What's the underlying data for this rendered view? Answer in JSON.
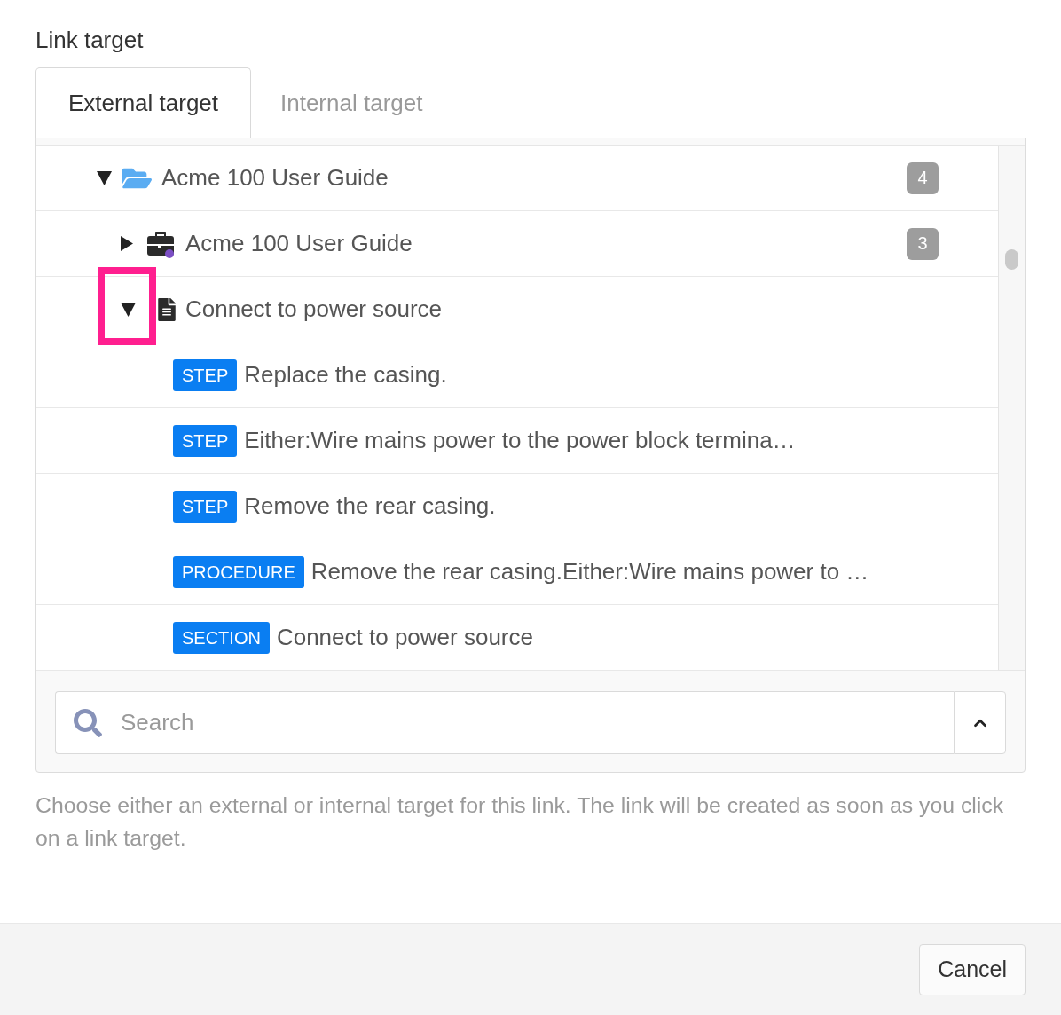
{
  "dialog": {
    "title": "Link target"
  },
  "tabs": [
    {
      "label": "External target",
      "selected": true
    },
    {
      "label": "Internal target",
      "selected": false
    }
  ],
  "tree": [
    {
      "kind": "folder",
      "label": "Acme 100 User Guide",
      "count": "4",
      "expanded": true,
      "highlighted": false,
      "children": [
        {
          "kind": "briefcase",
          "label": "Acme 100 User Guide",
          "count": "3",
          "expanded": false,
          "highlighted": false
        },
        {
          "kind": "document",
          "label": "Connect to power source",
          "expanded": true,
          "highlighted": true,
          "children": [
            {
              "kind": "entry",
              "badge": "STEP",
              "label": "Replace the casing."
            },
            {
              "kind": "entry",
              "badge": "STEP",
              "label": "Either:Wire mains power to the power block termina…"
            },
            {
              "kind": "entry",
              "badge": "STEP",
              "label": "Remove the rear casing."
            },
            {
              "kind": "entry",
              "badge": "PROCEDURE",
              "label": "Remove the rear casing.Either:Wire mains power to …"
            },
            {
              "kind": "entry",
              "badge": "SECTION",
              "label": "Connect to power source"
            }
          ]
        }
      ]
    }
  ],
  "search": {
    "placeholder": "Search"
  },
  "help_text": "Choose either an external or internal target for this link. The link will be created as soon as you click on a link target.",
  "buttons": [
    "Cancel"
  ]
}
